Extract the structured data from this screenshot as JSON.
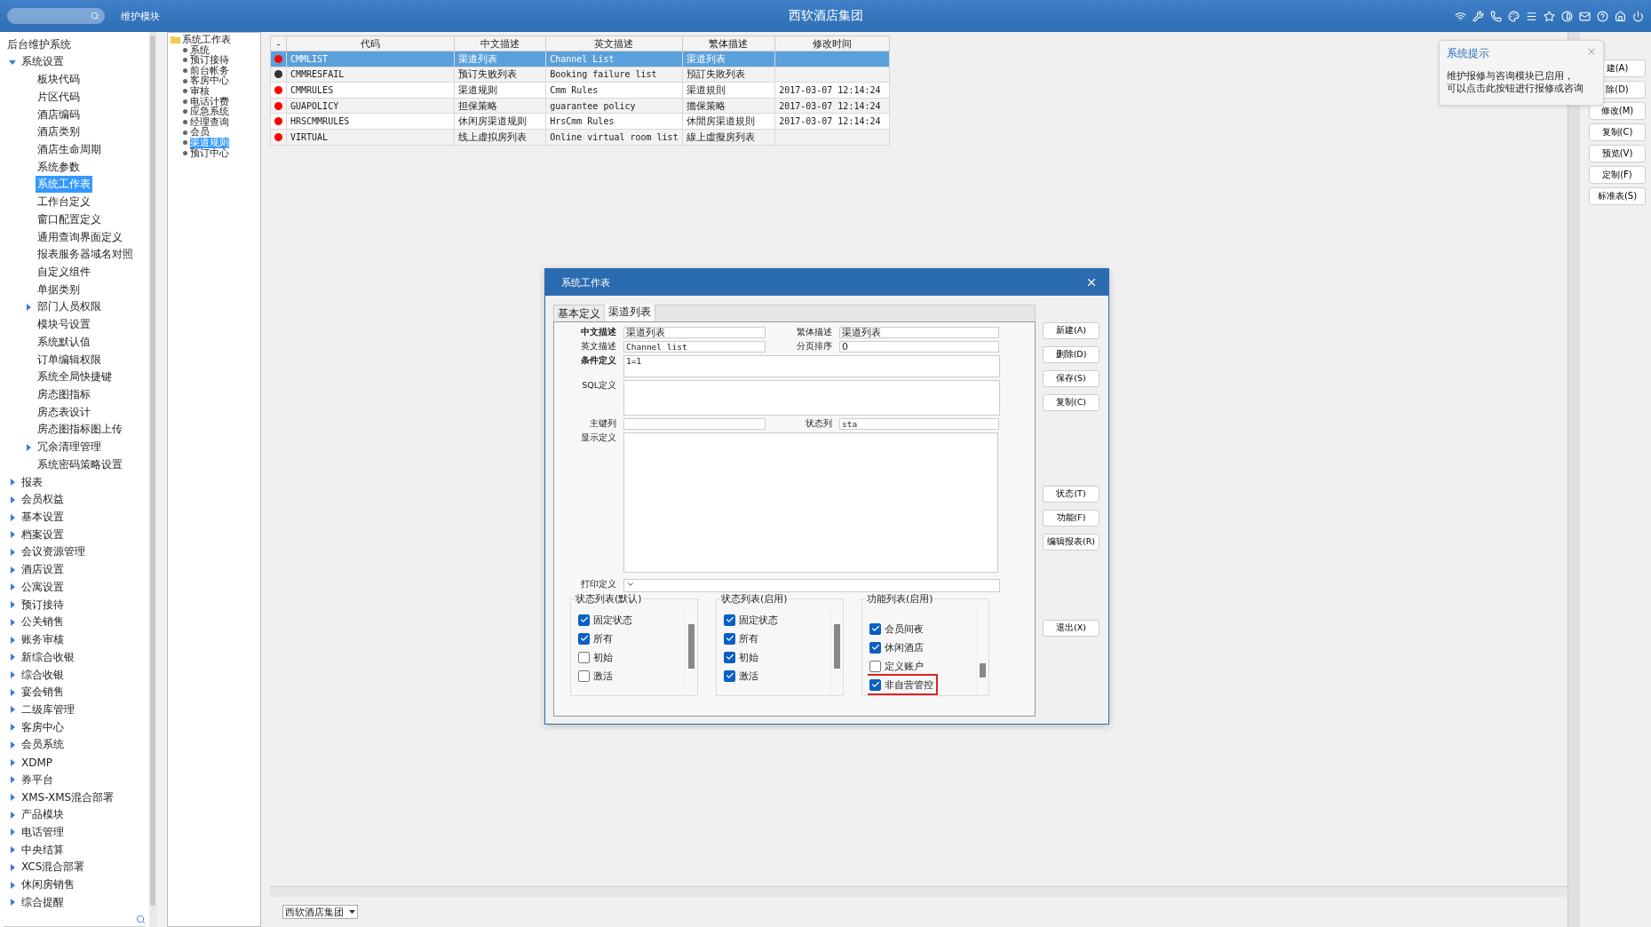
{
  "top_bar": {
    "module_label": "维护模块",
    "title": "西软酒店集团"
  },
  "sidebar": {
    "title": "后台维护系统",
    "items": [
      {
        "label": "系统设置",
        "expanded": true,
        "selected": false,
        "children": [
          {
            "label": "板块代码",
            "selected": false
          },
          {
            "label": "片区代码",
            "selected": false
          },
          {
            "label": "酒店编码",
            "selected": false
          },
          {
            "label": "酒店类别",
            "selected": false
          },
          {
            "label": "酒店生命周期",
            "selected": false
          },
          {
            "label": "系统参数",
            "selected": false
          },
          {
            "label": "系统工作表",
            "selected": true
          },
          {
            "label": "工作台定义",
            "selected": false
          },
          {
            "label": "窗口配置定义",
            "selected": false
          },
          {
            "label": "通用查询界面定义",
            "selected": false
          },
          {
            "label": "报表服务器域名对照",
            "selected": false
          },
          {
            "label": "自定义组件",
            "selected": false
          },
          {
            "label": "单据类别",
            "selected": false
          },
          {
            "label": "部门人员权限",
            "expanded": false,
            "selected": false
          },
          {
            "label": "模块号设置",
            "selected": false
          },
          {
            "label": "系统默认值",
            "selected": false
          },
          {
            "label": "订单编辑权限",
            "selected": false
          },
          {
            "label": "系统全局快捷键",
            "selected": false
          },
          {
            "label": "房态图指标",
            "selected": false
          },
          {
            "label": "房态表设计",
            "selected": false
          },
          {
            "label": "房态图指标图上传",
            "selected": false
          },
          {
            "label": "冗余清理管理",
            "expanded": false,
            "selected": false
          },
          {
            "label": "系统密码策略设置",
            "selected": false
          }
        ]
      },
      {
        "label": "报表",
        "expanded": false,
        "selected": false
      },
      {
        "label": "会员权益",
        "expanded": false,
        "selected": false
      },
      {
        "label": "基本设置",
        "expanded": false,
        "selected": false
      },
      {
        "label": "档案设置",
        "expanded": false,
        "selected": false
      },
      {
        "label": "会议资源管理",
        "expanded": false,
        "selected": false
      },
      {
        "label": "酒店设置",
        "expanded": false,
        "selected": false
      },
      {
        "label": "公寓设置",
        "expanded": false,
        "selected": false
      },
      {
        "label": "预订接待",
        "expanded": false,
        "selected": false
      },
      {
        "label": "公关销售",
        "expanded": false,
        "selected": false
      },
      {
        "label": "账务审核",
        "expanded": false,
        "selected": false
      },
      {
        "label": "新综合收银",
        "expanded": false,
        "selected": false
      },
      {
        "label": "综合收银",
        "expanded": false,
        "selected": false
      },
      {
        "label": "宴会销售",
        "expanded": false,
        "selected": false
      },
      {
        "label": "二级库管理",
        "expanded": false,
        "selected": false
      },
      {
        "label": "客房中心",
        "expanded": false,
        "selected": false
      },
      {
        "label": "会员系统",
        "expanded": false,
        "selected": false
      },
      {
        "label": "XDMP",
        "expanded": false,
        "selected": false
      },
      {
        "label": "券平台",
        "expanded": false,
        "selected": false
      },
      {
        "label": "XMS-XMS混合部署",
        "expanded": false,
        "selected": false
      },
      {
        "label": "产品模块",
        "expanded": false,
        "selected": false
      },
      {
        "label": "电话管理",
        "expanded": false,
        "selected": false
      },
      {
        "label": "中央结算",
        "expanded": false,
        "selected": false
      },
      {
        "label": "XCS混合部署",
        "expanded": false,
        "selected": false
      },
      {
        "label": "休闲房销售",
        "expanded": false,
        "selected": false
      },
      {
        "label": "综合提醒",
        "expanded": false,
        "selected": false
      }
    ]
  },
  "tree": {
    "root": "系统工作表",
    "items": [
      {
        "label": "系统",
        "selected": false
      },
      {
        "label": "预订接待",
        "selected": false
      },
      {
        "label": "前台帐务",
        "selected": false
      },
      {
        "label": "客房中心",
        "selected": false
      },
      {
        "label": "审核",
        "selected": false
      },
      {
        "label": "电话计费",
        "selected": false
      },
      {
        "label": "应急系统",
        "selected": false
      },
      {
        "label": "经理查询",
        "selected": false
      },
      {
        "label": "会员",
        "selected": false
      },
      {
        "label": "渠道规则",
        "selected": true
      },
      {
        "label": "预订中心",
        "selected": false
      }
    ]
  },
  "table": {
    "columns": [
      "-",
      "代码",
      "中文描述",
      "英文描述",
      "繁体描述",
      "修改时间"
    ],
    "rows": [
      {
        "color": "#ff0000",
        "code": "CMMLIST",
        "cn": "渠道列表",
        "en": "Channel List",
        "tw": "渠道列表",
        "modified": "",
        "selected": true
      },
      {
        "color": "#333333",
        "code": "CMMRESFAIL",
        "cn": "预订失败列表",
        "en": "Booking failure list",
        "tw": "預訂失敗列表",
        "modified": "",
        "selected": false
      },
      {
        "color": "#ff0000",
        "code": "CMMRULES",
        "cn": "渠道规则",
        "en": "Cmm Rules",
        "tw": "渠道規則",
        "modified": "2017-03-07 12:14:24",
        "selected": false
      },
      {
        "color": "#ff0000",
        "code": "GUAPOLICY",
        "cn": "担保策略",
        "en": "guarantee policy",
        "tw": "擔保策略",
        "modified": "2017-03-07 12:14:24",
        "selected": false
      },
      {
        "color": "#ff0000",
        "code": "HRSCMMRULES",
        "cn": "休闲房渠道规则",
        "en": "HrsCmm Rules",
        "tw": "休閒房渠道規則",
        "modified": "2017-03-07 12:14:24",
        "selected": false
      },
      {
        "color": "#ff0000",
        "code": "VIRTUAL",
        "cn": "线上虚拟房列表",
        "en": "Online virtual room list",
        "tw": "線上虛擬房列表",
        "modified": "",
        "selected": false
      }
    ]
  },
  "bottom_bar": {
    "hotel_select": "西软酒店集团"
  },
  "right_buttons": [
    "建(A)",
    "除(D)",
    "修改(M)",
    "复制(C)",
    "预览(V)",
    "定制(F)",
    "标准表(S)"
  ],
  "tooltip": {
    "title": "系统提示",
    "lines": [
      "维护报修与咨询模块已启用，",
      "可以点击此按钮进行报修或咨询"
    ]
  },
  "dialog": {
    "title": "系统工作表",
    "tabs": [
      {
        "label": "基本定义",
        "selected": false
      },
      {
        "label": "渠道列表",
        "selected": true
      }
    ],
    "fields": {
      "cn_desc": {
        "label": "中文描述",
        "value": "渠道列表",
        "required": true
      },
      "tw_desc": {
        "label": "繁体描述",
        "value": "渠道列表",
        "required": false
      },
      "en_desc": {
        "label": "英文描述",
        "value": "Channel list",
        "required": false
      },
      "page_order": {
        "label": "分页排序",
        "value": "0",
        "required": false
      },
      "condition": {
        "label": "条件定义",
        "value": "1=1",
        "required": true
      },
      "sql": {
        "label": "SQL定义",
        "required": false
      },
      "key_column": {
        "label": "主键列",
        "required": false
      },
      "status_column": {
        "label": "状态列",
        "value": "sta",
        "required": false
      },
      "display": {
        "label": "显示定义",
        "required": false
      },
      "print": {
        "label": "打印定义",
        "required": false
      }
    },
    "lists": [
      {
        "title": "状态列表(默认)",
        "scrolled": false,
        "items": [
          {
            "label": "固定状态",
            "checked": true,
            "outlined": false
          },
          {
            "label": "所有",
            "checked": true,
            "outlined": false
          },
          {
            "label": "初始",
            "checked": false,
            "outlined": false
          },
          {
            "label": "激活",
            "checked": false,
            "outlined": false
          }
        ]
      },
      {
        "title": "状态列表(启用)",
        "scrolled": false,
        "items": [
          {
            "label": "固定状态",
            "checked": true,
            "outlined": false
          },
          {
            "label": "所有",
            "checked": true,
            "outlined": false
          },
          {
            "label": "初始",
            "checked": true,
            "outlined": false
          },
          {
            "label": "激活",
            "checked": true,
            "outlined": false
          }
        ]
      },
      {
        "title": "功能列表(启用)",
        "scrolled": true,
        "items": [
          {
            "label": "会员间夜",
            "checked": true,
            "outlined": false
          },
          {
            "label": "休闲酒店",
            "checked": true,
            "outlined": false
          },
          {
            "label": "定义账户",
            "checked": false,
            "outlined": false
          },
          {
            "label": "非自营管控",
            "checked": true,
            "outlined": true
          }
        ]
      }
    ],
    "button_groups": [
      [
        "新建(A)",
        "删除(D)",
        "保存(S)",
        "复制(C)"
      ],
      [
        "状态(T)",
        "功能(F)",
        "编辑报表(R)"
      ],
      [
        "退出(X)"
      ]
    ]
  }
}
